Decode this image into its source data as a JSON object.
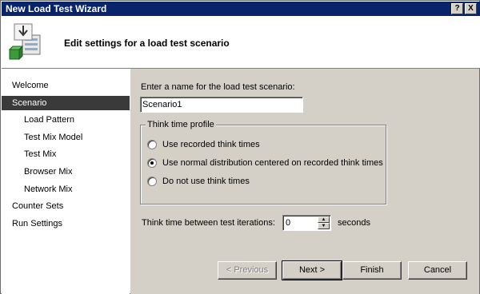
{
  "window": {
    "title": "New Load Test Wizard",
    "help_btn": "?",
    "close_btn": "X"
  },
  "header": {
    "title": "Edit settings for a load test scenario",
    "icon": "load-test-wizard-icon"
  },
  "nav": {
    "items": [
      {
        "label": "Welcome"
      },
      {
        "label": "Scenario"
      },
      {
        "label": "Load Pattern"
      },
      {
        "label": "Test Mix Model"
      },
      {
        "label": "Test Mix"
      },
      {
        "label": "Browser Mix"
      },
      {
        "label": "Network Mix"
      },
      {
        "label": "Counter Sets"
      },
      {
        "label": "Run Settings"
      }
    ],
    "selected": "Scenario"
  },
  "form": {
    "name_label": "Enter a name for the load test scenario:",
    "name_value": "Scenario1",
    "think_profile": {
      "title": "Think time profile",
      "options": [
        "Use recorded think times",
        "Use normal distribution centered on recorded think times",
        "Do not use think times"
      ],
      "selected": "Use normal distribution centered on recorded think times"
    },
    "iter_label": "Think time between test iterations:",
    "iter_value": "0",
    "iter_unit": "seconds"
  },
  "buttons": {
    "previous": "< Previous",
    "next": "Next >",
    "finish": "Finish",
    "cancel": "Cancel"
  },
  "colors": {
    "titlebar": "#0a246a",
    "panel": "#d4d0c8",
    "nav_selected": "#3a3a3a"
  }
}
